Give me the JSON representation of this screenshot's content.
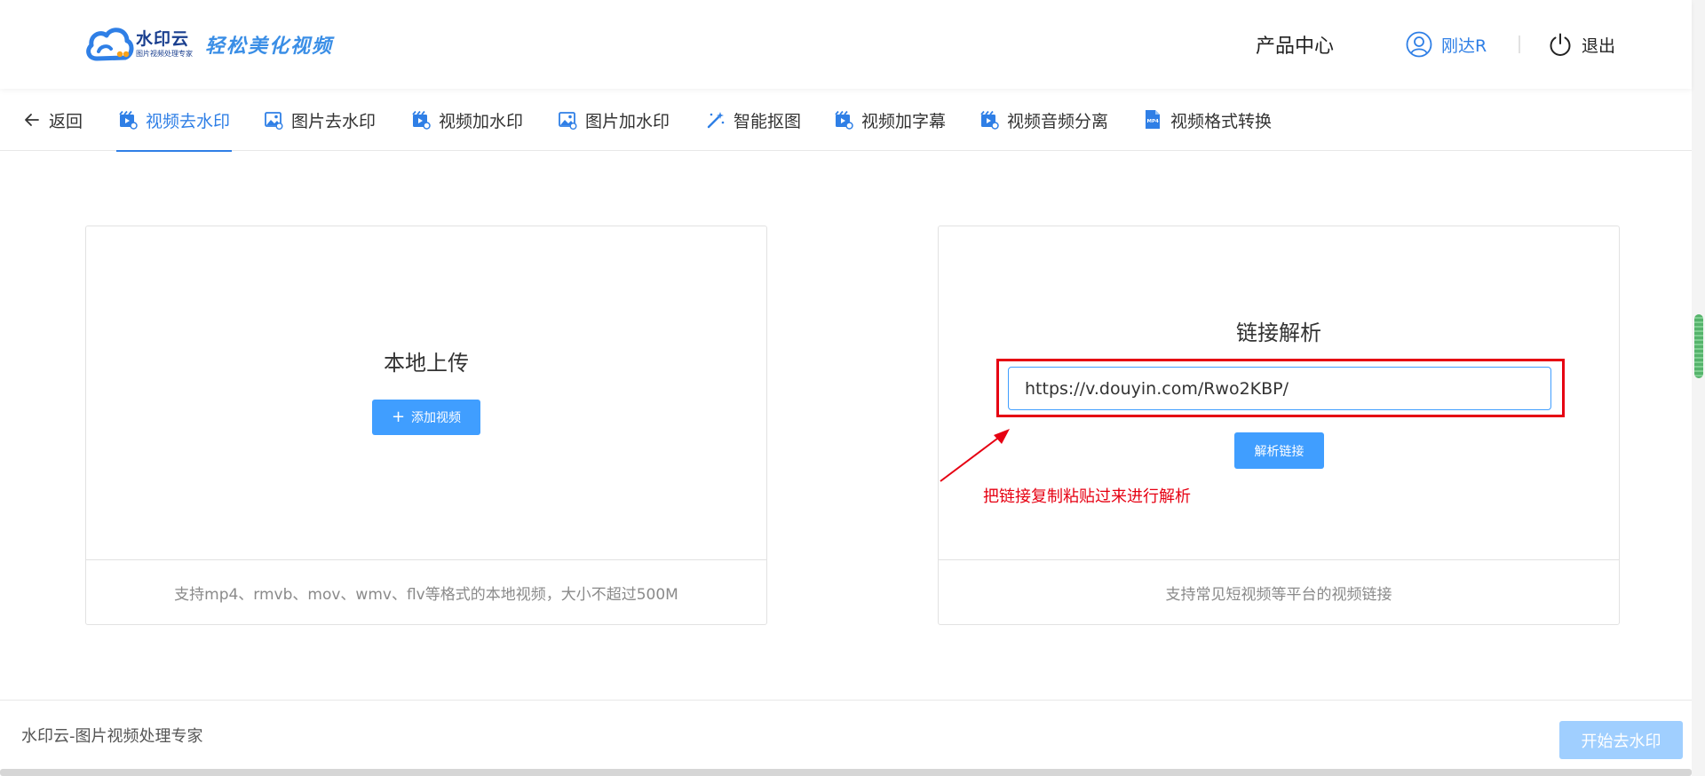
{
  "brand": {
    "name": "水印云",
    "tagline": "图片视频处理专家",
    "slogan": "轻松美化视频",
    "color": "#2f7fe6"
  },
  "header": {
    "products": "产品中心",
    "username": "刚达R",
    "logout": "退出"
  },
  "nav": {
    "back": "返回",
    "items": [
      {
        "label": "视频去水印",
        "icon": "video-icon",
        "active": true
      },
      {
        "label": "图片去水印",
        "icon": "image-icon"
      },
      {
        "label": "视频加水印",
        "icon": "video-icon"
      },
      {
        "label": "图片加水印",
        "icon": "image-icon"
      },
      {
        "label": "智能抠图",
        "icon": "magic-wand-icon"
      },
      {
        "label": "视频加字幕",
        "icon": "video-icon"
      },
      {
        "label": "视频音频分离",
        "icon": "video-icon"
      },
      {
        "label": "视频格式转换",
        "icon": "mp4-file-icon"
      }
    ]
  },
  "local_upload": {
    "title": "本地上传",
    "button": "添加视频",
    "footer": "支持mp4、rmvb、mov、wmv、flv等格式的本地视频，大小不超过500M"
  },
  "link_parse": {
    "title": "链接解析",
    "input_value": "https://v.douyin.com/Rwo2KBP/",
    "button": "解析链接",
    "annotation": "把链接复制粘贴过来进行解析",
    "footer": "支持常见短视频等平台的视频链接"
  },
  "footer": {
    "text": "水印云-图片视频处理专家",
    "start_button": "开始去水印"
  }
}
